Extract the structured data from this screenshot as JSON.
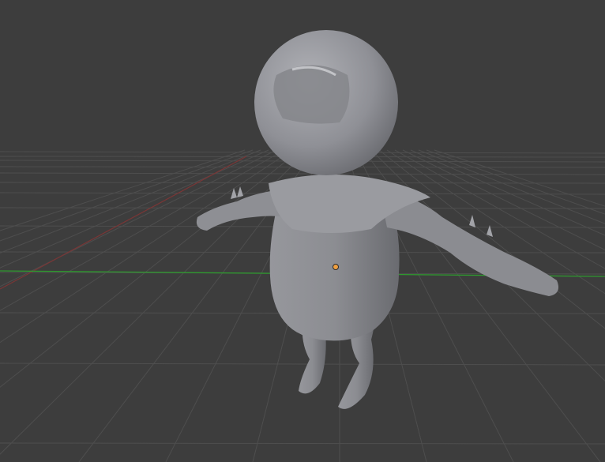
{
  "viewport": {
    "background": "#3d3d3d",
    "grid_color": "#4e4e4e",
    "x_axis_color": "#2f9a2f",
    "y_axis_color": "#7a3636",
    "model_color": "#8f9096",
    "model_highlight": "#b4b5ba",
    "model_shadow": "#606166",
    "origin_color": "#f0a040"
  }
}
